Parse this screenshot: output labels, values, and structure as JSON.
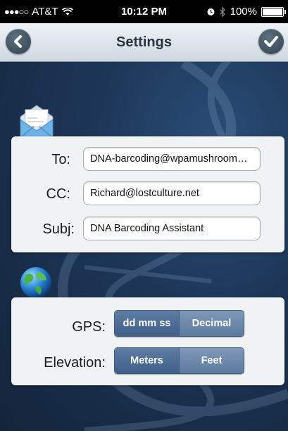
{
  "status_bar": {
    "carrier": "AT&T",
    "time": "10:12 PM",
    "battery": "100%",
    "battery_level": 1.0,
    "signal_bars_filled": 3,
    "signal_bars_total": 5
  },
  "nav": {
    "title": "Settings",
    "back_icon": "chevron-left-icon",
    "done_icon": "checkmark-icon"
  },
  "email": {
    "to_label": "To:",
    "to_value": "DNA-barcoding@wpamushroom…",
    "cc_label": "CC:",
    "cc_value": "Richard@lostculture.net",
    "subj_label": "Subj:",
    "subj_value": "DNA Barcoding Assistant",
    "icon": "envelope-icon"
  },
  "units": {
    "gps_label": "GPS:",
    "gps_options": [
      "dd mm ss",
      "Decimal"
    ],
    "gps_selected": "dd mm ss",
    "elevation_label": "Elevation:",
    "elevation_options": [
      "Meters",
      "Feet"
    ],
    "elevation_selected": "Meters",
    "icon": "globe-icon"
  },
  "colors": {
    "background": "#1d3658",
    "navbar": "#dfe5eb",
    "segment": "#6a86aa",
    "segment_selected": "#4a6a93"
  }
}
